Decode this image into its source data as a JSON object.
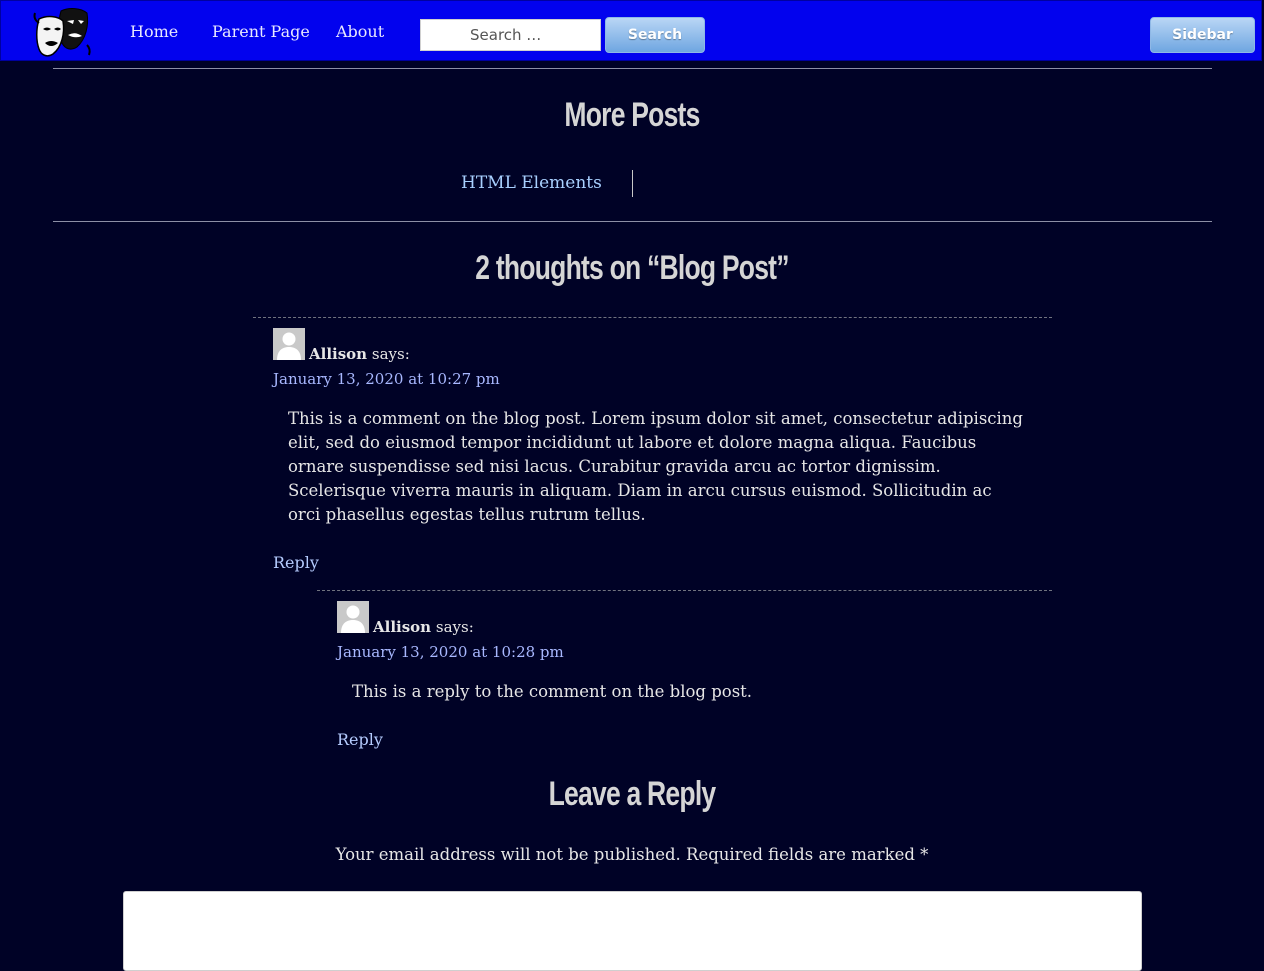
{
  "header": {
    "nav": [
      {
        "label": "Home"
      },
      {
        "label": "Parent Page"
      },
      {
        "label": "About"
      }
    ],
    "search": {
      "placeholder": "Search …",
      "button_label": "Search"
    },
    "sidebar_button_label": "Sidebar"
  },
  "more_posts": {
    "heading": "More Posts",
    "link_label": "HTML Elements"
  },
  "comments": {
    "heading": "2 thoughts on “Blog Post”",
    "items": [
      {
        "author": "Allison",
        "says": "says:",
        "date": "January 13, 2020 at 10:27 pm",
        "text": "This is a comment on the blog post. Lorem ipsum dolor sit amet, consectetur adipiscing elit, sed do eiusmod tempor incididunt ut labore et dolore magna aliqua. Faucibus ornare suspendisse sed nisi lacus. Curabitur gravida arcu ac tortor dignissim. Scelerisque viverra mauris in aliquam. Diam in arcu cursus euismod. Sollicitudin ac orci phasellus egestas tellus rutrum tellus.",
        "reply_label": "Reply"
      },
      {
        "author": "Allison",
        "says": "says:",
        "date": "January 13, 2020 at 10:28 pm",
        "text": "This is a reply to the comment on the blog post.",
        "reply_label": "Reply"
      }
    ]
  },
  "reply_form": {
    "heading": "Leave a Reply",
    "notes": "Your email address will not be published. Required fields are marked *"
  },
  "icons": {
    "logo": "theater-masks-logo",
    "avatar": "default-user-avatar"
  },
  "colors": {
    "background": "#000226",
    "topbar": "#0202ee",
    "link": "#a8d0ff",
    "button_gradient_top": "#b9d6f5",
    "button_gradient_bottom": "#6fa6e1"
  }
}
